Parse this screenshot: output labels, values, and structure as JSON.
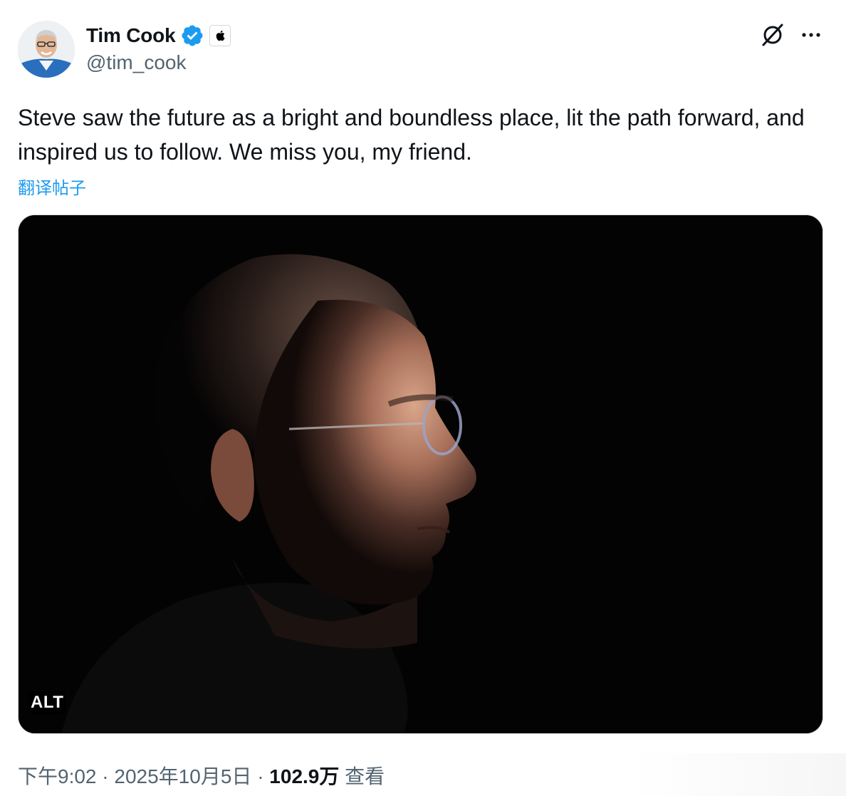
{
  "author": {
    "display_name": "Tim Cook",
    "handle": "@tim_cook",
    "verified": true,
    "affiliate_badge": "apple-logo-icon"
  },
  "header_actions": {
    "grok_icon": "grok-icon",
    "more_icon": "more-options-icon"
  },
  "tweet": {
    "text": "Steve saw the future as a bright and boundless place, lit the path forward, and inspired us to follow. We miss you, my friend.",
    "translate_label": "翻译帖子"
  },
  "media": {
    "alt_badge": "ALT"
  },
  "meta": {
    "time": "下午9:02",
    "separator": "·",
    "date": "2025年10月5日",
    "views": "102.9万",
    "views_label": "查看"
  },
  "colors": {
    "text_primary": "#0f1419",
    "text_secondary": "#536471",
    "link": "#1d9bf0",
    "verified": "#1d9bf0"
  }
}
